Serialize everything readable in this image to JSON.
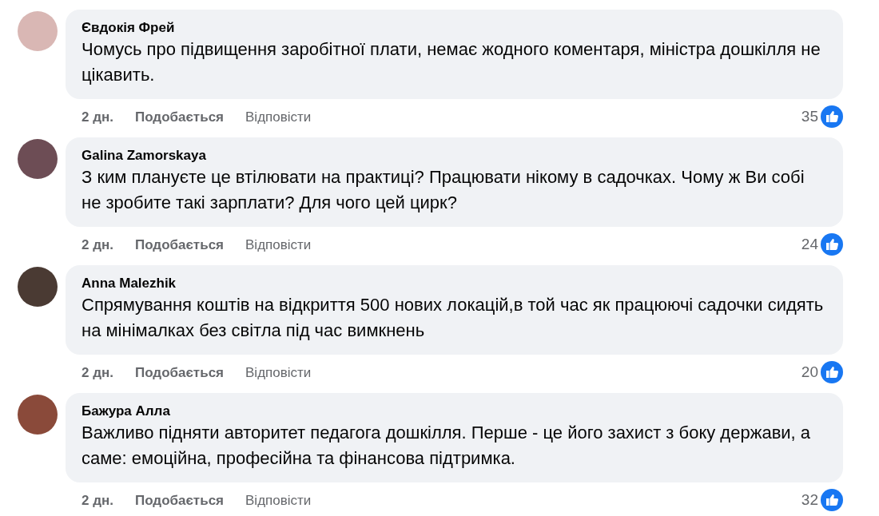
{
  "comments": [
    {
      "author": "Євдокія Фрей",
      "text": "Чомусь про підвищення заробітної плати, немає жодного коментаря, міністра дошкілля не цікавить.",
      "time": "2 дн.",
      "like": "Подобається",
      "reply": "Відповісти",
      "reactions": "35"
    },
    {
      "author": "Galina Zamorskaya",
      "text": "З ким плануєте це втілювати на практиці? Працювати нікому в садочках. Чому ж Ви собі не зробите такі зарплати? Для чого цей цирк?",
      "time": "2 дн.",
      "like": "Подобається",
      "reply": "Відповісти",
      "reactions": "24"
    },
    {
      "author": "Anna Malezhik",
      "text": "Спрямування коштів на відкриття 500 нових локацій,в той час як працюючі садочки сидять на мінімалках без світла під час вимкнень",
      "time": "2 дн.",
      "like": "Подобається",
      "reply": "Відповісти",
      "reactions": "20"
    },
    {
      "author": "Бажура Алла",
      "text": "Важливо підняти авторитет педагога дошкілля. Перше - це його захист з боку держави, а саме: емоційна, професійна та фінансова підтримка.",
      "time": "2 дн.",
      "like": "Подобається",
      "reply": "Відповісти",
      "reactions": "32"
    }
  ]
}
